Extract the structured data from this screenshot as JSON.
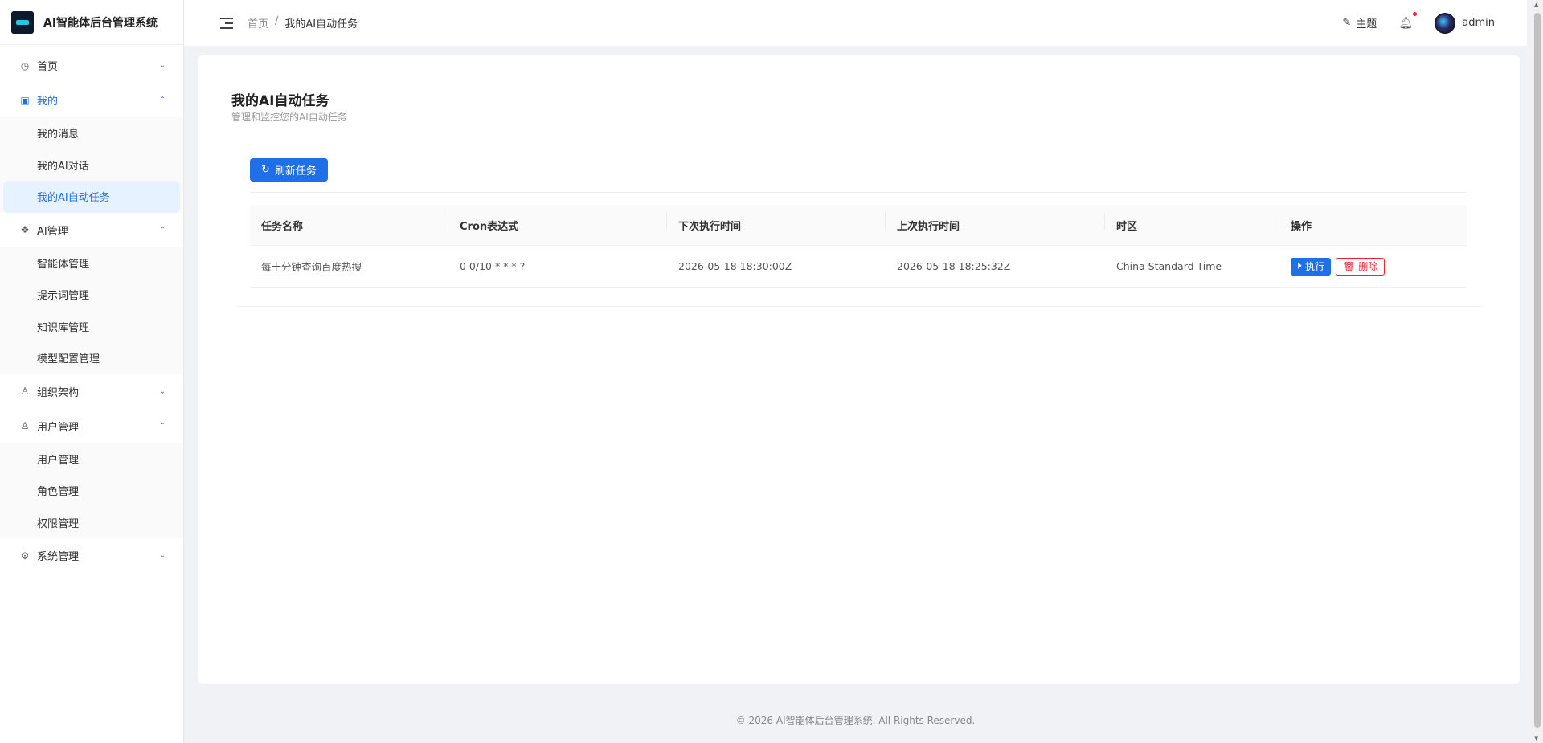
{
  "brand": {
    "title": "AI智能体后台管理系统"
  },
  "sidebar": {
    "groups": [
      {
        "label": "首页",
        "icon": "dashboard-icon",
        "expanded": false,
        "items": []
      },
      {
        "label": "我的",
        "icon": "profile-icon",
        "expanded": true,
        "active": true,
        "items": [
          {
            "label": "我的消息"
          },
          {
            "label": "我的AI对话"
          },
          {
            "label": "我的AI自动任务",
            "active": true
          }
        ]
      },
      {
        "label": "AI管理",
        "icon": "ai-icon",
        "expanded": true,
        "items": [
          {
            "label": "智能体管理"
          },
          {
            "label": "提示词管理"
          },
          {
            "label": "知识库管理"
          },
          {
            "label": "模型配置管理"
          }
        ]
      },
      {
        "label": "组织架构",
        "icon": "user-icon",
        "expanded": false,
        "items": []
      },
      {
        "label": "用户管理",
        "icon": "user-icon",
        "expanded": true,
        "items": [
          {
            "label": "用户管理"
          },
          {
            "label": "角色管理"
          },
          {
            "label": "权限管理"
          }
        ]
      },
      {
        "label": "系统管理",
        "icon": "gear-icon",
        "expanded": false,
        "items": []
      }
    ]
  },
  "header": {
    "breadcrumb": {
      "home": "首页",
      "separator": "/",
      "current": "我的AI自动任务"
    },
    "theme_label": "主题",
    "username": "admin"
  },
  "main": {
    "title": "我的AI自动任务",
    "subtitle": "管理和监控您的AI自动任务",
    "refresh_label": "刷新任务",
    "table": {
      "columns": [
        "任务名称",
        "Cron表达式",
        "下次执行时间",
        "上次执行时间",
        "时区",
        "操作"
      ],
      "rows": [
        {
          "name": "每十分钟查询百度热搜",
          "cron": "0 0/10 * * * ?",
          "next": "2026-05-18 18:30:00Z",
          "last": "2026-05-18 18:25:32Z",
          "tz": "China Standard Time",
          "exec_label": "执行",
          "delete_label": "删除"
        }
      ]
    }
  },
  "footer": {
    "text": "© 2026 AI智能体后台管理系统. All Rights Reserved."
  },
  "colors": {
    "primary": "#1e6fe8",
    "danger": "#f5222d",
    "active_bg": "#e6f2ff"
  }
}
